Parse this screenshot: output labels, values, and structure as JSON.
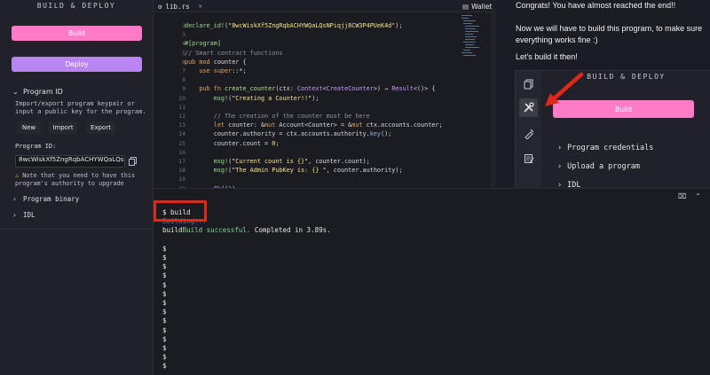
{
  "sidebar": {
    "title": "BUILD & DEPLOY",
    "build_label": "Build",
    "deploy_label": "Deploy",
    "program_id_section": "Program ID",
    "program_id_desc": "Import/export program keypair or input a public key for the program.",
    "new_label": "New",
    "import_label": "Import",
    "export_label": "Export",
    "program_id_label": "Program ID:",
    "program_id_value": "8wcWiskXf5ZngRqbACHYWQaLQsNPiqjj8CW3P4PUeK4d",
    "note": "Note that you need to have this program's authority to upgrade",
    "program_binary_section": "Program binary",
    "idl_section": "IDL",
    "colors": {
      "build": "#ff7bc8",
      "deploy": "#b985f0"
    }
  },
  "editor": {
    "tab_file": "lib.rs",
    "tab_wallet": "Wallet",
    "line_numbers": [
      "2",
      "3",
      "4",
      "5",
      "6",
      "7",
      "8",
      "9",
      "10",
      "11",
      "12",
      "13",
      "14",
      "15",
      "16",
      "17",
      "18",
      "19",
      "20",
      "21"
    ]
  },
  "terminal": {
    "command": "$ build",
    "building": "Building...",
    "result_prefix": "build",
    "result_success": "Build successful.",
    "result_suffix": " Completed in 3.89s.",
    "prompts": [
      "$",
      "$",
      "$",
      "$",
      "$",
      "$",
      "$",
      "$",
      "$",
      "$",
      "$",
      "$",
      "$",
      "$"
    ]
  },
  "right": {
    "msg1": "Congrats! You have almost reached the end!!",
    "msg2": "Now we will have to build this program, to make sure everything works fine :)",
    "msg3": "Let's build it then!",
    "mini_title": "BUILD & DEPLOY",
    "mini_build_label": "Build",
    "rows": [
      "Program credentials",
      "Upload a program",
      "IDL"
    ]
  }
}
